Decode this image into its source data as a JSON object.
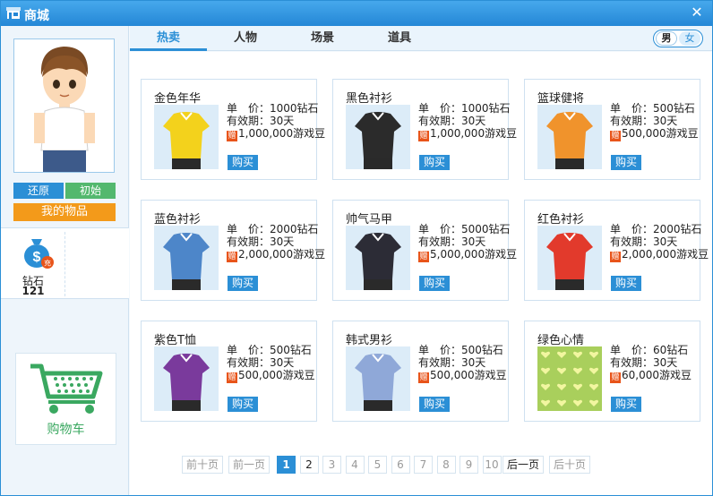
{
  "window": {
    "title": "商城",
    "close_glyph": "✕"
  },
  "left": {
    "restore_label": "还原",
    "initial_label": "初始",
    "my_items_label": "我的物品",
    "diamond_label": "钻石",
    "diamond_value": "121",
    "recharge_badge": "充",
    "cart_label": "购物车"
  },
  "tabs": [
    {
      "label": "热卖",
      "active": true
    },
    {
      "label": "人物",
      "active": false
    },
    {
      "label": "场景",
      "active": false
    },
    {
      "label": "道具",
      "active": false
    }
  ],
  "gender": {
    "male": "男",
    "female": "女",
    "selected": "男"
  },
  "price_prefix": "单　价：",
  "validity_prefix": "有效期：",
  "gift_tag": "赠",
  "buy_label": "购买",
  "items": [
    {
      "name": "金色年华",
      "price": "1000钻石",
      "validity": "30天",
      "bonus": "1,000,000游戏豆",
      "color": "#f3d21c"
    },
    {
      "name": "黑色衬衫",
      "price": "1000钻石",
      "validity": "30天",
      "bonus": "1,000,000游戏豆",
      "color": "#2b2b2b"
    },
    {
      "name": "篮球健将",
      "price": "500钻石",
      "validity": "30天",
      "bonus": "500,000游戏豆",
      "color": "#f0932c"
    },
    {
      "name": "蓝色衬衫",
      "price": "2000钻石",
      "validity": "30天",
      "bonus": "2,000,000游戏豆",
      "color": "#4d86c9"
    },
    {
      "name": "帅气马甲",
      "price": "5000钻石",
      "validity": "30天",
      "bonus": "5,000,000游戏豆",
      "color": "#2c2c36"
    },
    {
      "name": "红色衬衫",
      "price": "2000钻石",
      "validity": "30天",
      "bonus": "2,000,000游戏豆",
      "color": "#e23a2c"
    },
    {
      "name": "紫色T恤",
      "price": "500钻石",
      "validity": "30天",
      "bonus": "500,000游戏豆",
      "color": "#7a3a9c"
    },
    {
      "name": "韩式男衫",
      "price": "500钻石",
      "validity": "30天",
      "bonus": "500,000游戏豆",
      "color": "#8fa8d8"
    },
    {
      "name": "绿色心情",
      "price": "60钻石",
      "validity": "30天",
      "bonus": "60,000游戏豆",
      "color": "#a9cf5c"
    }
  ],
  "pagination": {
    "prev10": "前十页",
    "prev": "前一页",
    "pages": [
      "1",
      "2",
      "3",
      "4",
      "5",
      "6",
      "7",
      "8",
      "9",
      "10"
    ],
    "current": "1",
    "next": "后一页",
    "next10": "后十页"
  }
}
